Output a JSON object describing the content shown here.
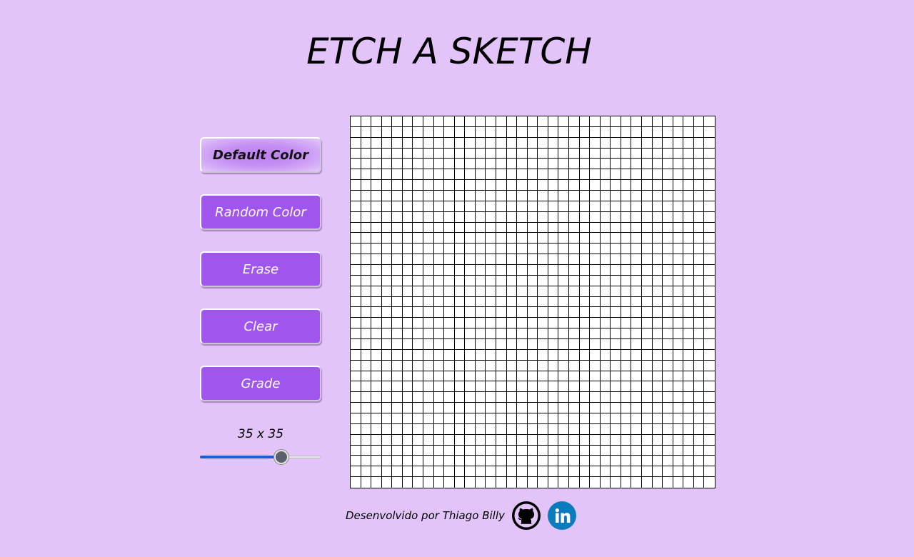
{
  "header": {
    "title": "ETCH A SKETCH"
  },
  "controls": {
    "buttons": [
      {
        "label": "Default Color",
        "active": true
      },
      {
        "label": "Random Color",
        "active": false
      },
      {
        "label": "Erase",
        "active": false
      },
      {
        "label": "Clear",
        "active": false
      },
      {
        "label": "Grade",
        "active": false
      }
    ],
    "size_label": "35 x 35",
    "slider": {
      "value": 35,
      "min": 1,
      "max": 50
    }
  },
  "grid": {
    "columns": 35,
    "rows": 35,
    "cell_color": "#ffffff",
    "line_color": "#000000"
  },
  "footer": {
    "credit": "Desenvolvido por Thiago Billy",
    "links": [
      {
        "icon": "github-icon"
      },
      {
        "icon": "linkedin-icon"
      }
    ]
  },
  "colors": {
    "background": "#e2c4f8",
    "button": "#a055ec",
    "slider_fill": "#1a5fd0",
    "linkedin": "#0a7bbd"
  }
}
